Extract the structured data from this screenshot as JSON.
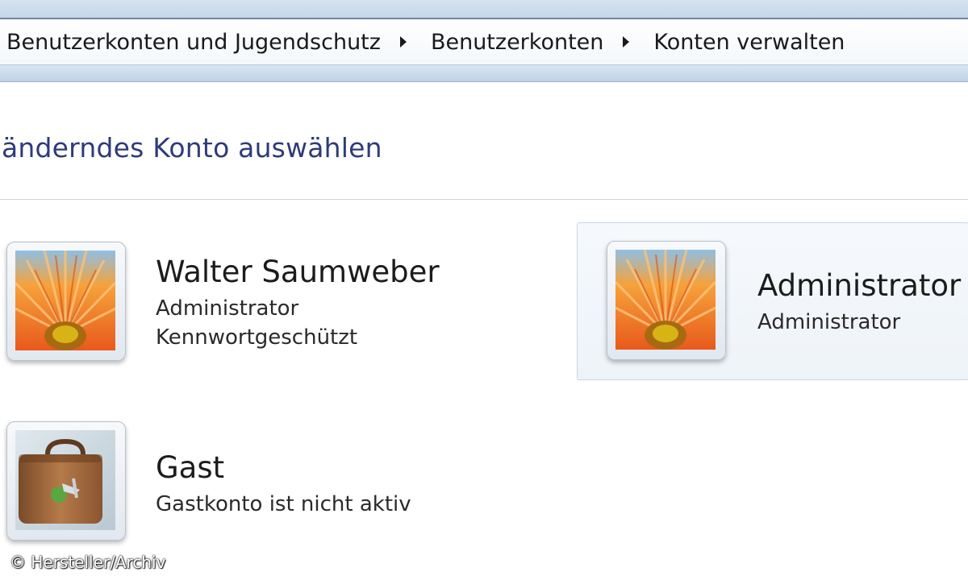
{
  "breadcrumb": {
    "items": [
      {
        "label": "Benutzerkonten und Jugendschutz"
      },
      {
        "label": "Benutzerkonten"
      },
      {
        "label": "Konten verwalten"
      }
    ]
  },
  "page": {
    "title": "änderndes Konto auswählen"
  },
  "accounts": [
    {
      "name": "Walter Saumweber",
      "type": "Administrator",
      "status": "Kennwortgeschützt",
      "picture": "flower-picture"
    },
    {
      "name": "Administrator",
      "type": "Administrator",
      "picture": "flower-picture",
      "selected": true
    },
    {
      "name": "Gast",
      "status": "Gastkonto ist nicht aktiv",
      "picture": "suitcase-picture"
    }
  ],
  "credit": "© Hersteller/Archiv",
  "colors": {
    "title": "#2e3b7a",
    "chrome": "#c6d7ea",
    "selection": "#eef3f8"
  }
}
